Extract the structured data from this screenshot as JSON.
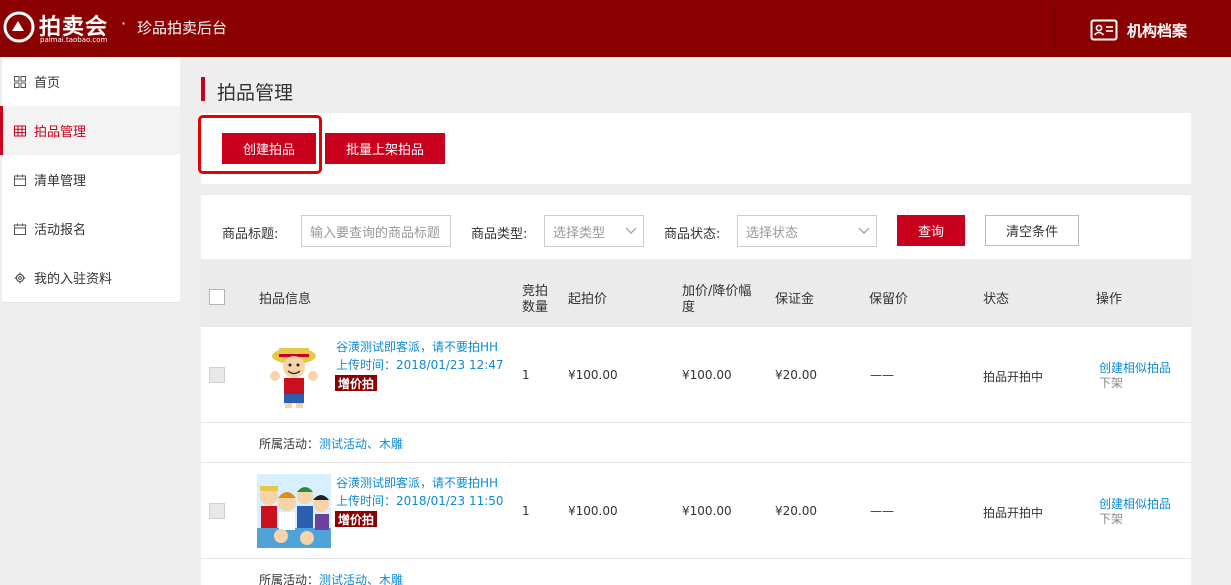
{
  "header": {
    "logo_text": "拍卖会",
    "logo_sub": "paimai.taobao.com",
    "dot": "·",
    "title": "珍品拍卖后台",
    "archive_label": "机构档案"
  },
  "sidebar": {
    "items": [
      {
        "label": "首页",
        "icon": "grid-icon",
        "active": false
      },
      {
        "label": "拍品管理",
        "icon": "table-icon",
        "active": true
      },
      {
        "label": "清单管理",
        "icon": "calendar-icon",
        "active": false
      },
      {
        "label": "活动报名",
        "icon": "calendar-icon",
        "active": false
      },
      {
        "label": "我的入驻资料",
        "icon": "gear-icon",
        "active": false
      }
    ]
  },
  "page": {
    "title": "拍品管理",
    "create_btn": "创建拍品",
    "batch_btn": "批量上架拍品"
  },
  "filter": {
    "title_label": "商品标题:",
    "title_placeholder": "输入要查询的商品标题",
    "type_label": "商品类型:",
    "type_placeholder": "选择类型",
    "status_label": "商品状态:",
    "status_placeholder": "选择状态",
    "query_btn": "查询",
    "clear_btn": "清空条件"
  },
  "table": {
    "headers": {
      "info": "拍品信息",
      "bid_qty_1": "竞拍",
      "bid_qty_2": "数量",
      "start_price": "起拍价",
      "increment_1": "加价/降价幅",
      "increment_2": "度",
      "deposit": "保证金",
      "reserve": "保留价",
      "status": "状态",
      "action": "操作"
    },
    "rows": [
      {
        "name": "谷潢测试即客派，请不要拍HH",
        "time": "上传时间：2018/01/23 12:47",
        "tag": "增价拍",
        "qty": "1",
        "start_price": "¥100.00",
        "increment": "¥100.00",
        "deposit": "¥20.00",
        "reserve": "——",
        "status": "拍品开拍中",
        "op_similar": "创建相似拍品",
        "op_off": "下架",
        "activity_label": "所属活动：",
        "activity_links": "测试活动、木雕"
      },
      {
        "name": "谷潢测试即客派，请不要拍HH",
        "time": "上传时间：2018/01/23 11:50",
        "tag": "增价拍",
        "qty": "1",
        "start_price": "¥100.00",
        "increment": "¥100.00",
        "deposit": "¥20.00",
        "reserve": "——",
        "status": "拍品开拍中",
        "op_similar": "创建相似拍品",
        "op_off": "下架",
        "activity_label": "所属活动：",
        "activity_links": "测试活动、木雕"
      }
    ]
  },
  "colors": {
    "header_bg": "#8b0000",
    "accent": "#c8001e",
    "link": "#0f8ad5"
  }
}
